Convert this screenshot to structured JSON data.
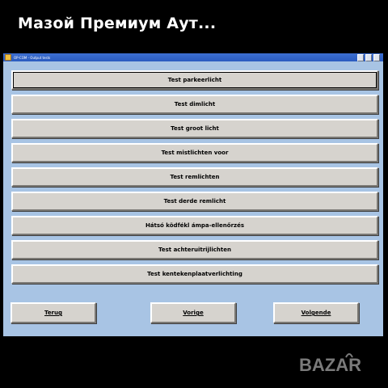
{
  "overlay": {
    "title": "Мазой Премиум Аут..."
  },
  "window": {
    "title": "OP-COM - Output tests",
    "controls": [
      "minimize-icon",
      "maximize-icon",
      "close-icon"
    ]
  },
  "tests": [
    {
      "label": "Test parkeerlicht"
    },
    {
      "label": "Test dimlicht"
    },
    {
      "label": "Test groot licht"
    },
    {
      "label": "Test mistlichten voor"
    },
    {
      "label": "Test remlichten"
    },
    {
      "label": "Test derde remlicht"
    },
    {
      "label": "Hátsó ködfékl ámpa-ellenőrzés"
    },
    {
      "label": "Test achteruitrijlichten"
    },
    {
      "label": "Test kentekenplaatverlichting"
    }
  ],
  "nav": {
    "back": "Terug",
    "prev": "Vorige",
    "next": "Volgende"
  },
  "watermark": {
    "text": "BAZAR"
  }
}
